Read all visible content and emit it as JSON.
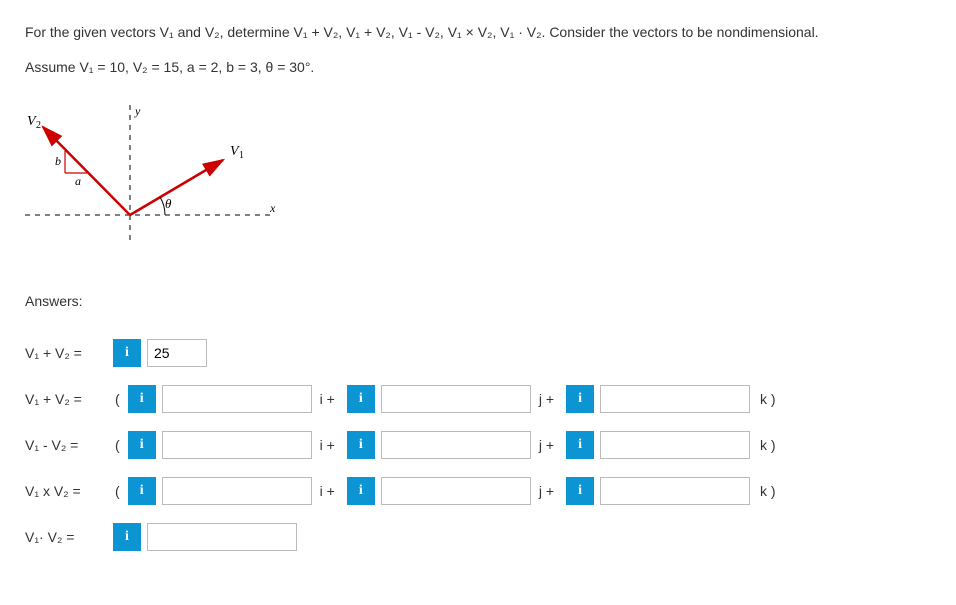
{
  "problem": {
    "line1": "For the given vectors V₁ and V₂, determine V₁ + V₂, V₁ + V₂, V₁ - V₂, V₁ × V₂, V₁ · V₂. Consider the vectors to be nondimensional.",
    "line2": "Assume V₁ = 10, V₂ = 15, a = 2, b = 3, θ = 30°."
  },
  "diagram": {
    "label_V1": "V₁",
    "label_V2": "V₂",
    "label_a": "a",
    "label_b": "b",
    "label_x": "x",
    "label_y": "y",
    "label_theta": "θ"
  },
  "answers_header": "Answers:",
  "rows": {
    "r1": {
      "label": "V₁ + V₂ =",
      "value": "25"
    },
    "r2": {
      "label": "V₁ + V₂ =",
      "open": "(",
      "unit_i": "i +",
      "unit_j": "j +",
      "unit_k": "k )"
    },
    "r3": {
      "label": "V₁ - V₂ =",
      "open": "(",
      "unit_i": "i +",
      "unit_j": "j +",
      "unit_k": "k )"
    },
    "r4": {
      "label": "V₁ x V₂ =",
      "open": "(",
      "unit_i": "i +",
      "unit_j": "j +",
      "unit_k": "k )"
    },
    "r5": {
      "label": "V₁· V₂ ="
    }
  },
  "info_icon": "i"
}
